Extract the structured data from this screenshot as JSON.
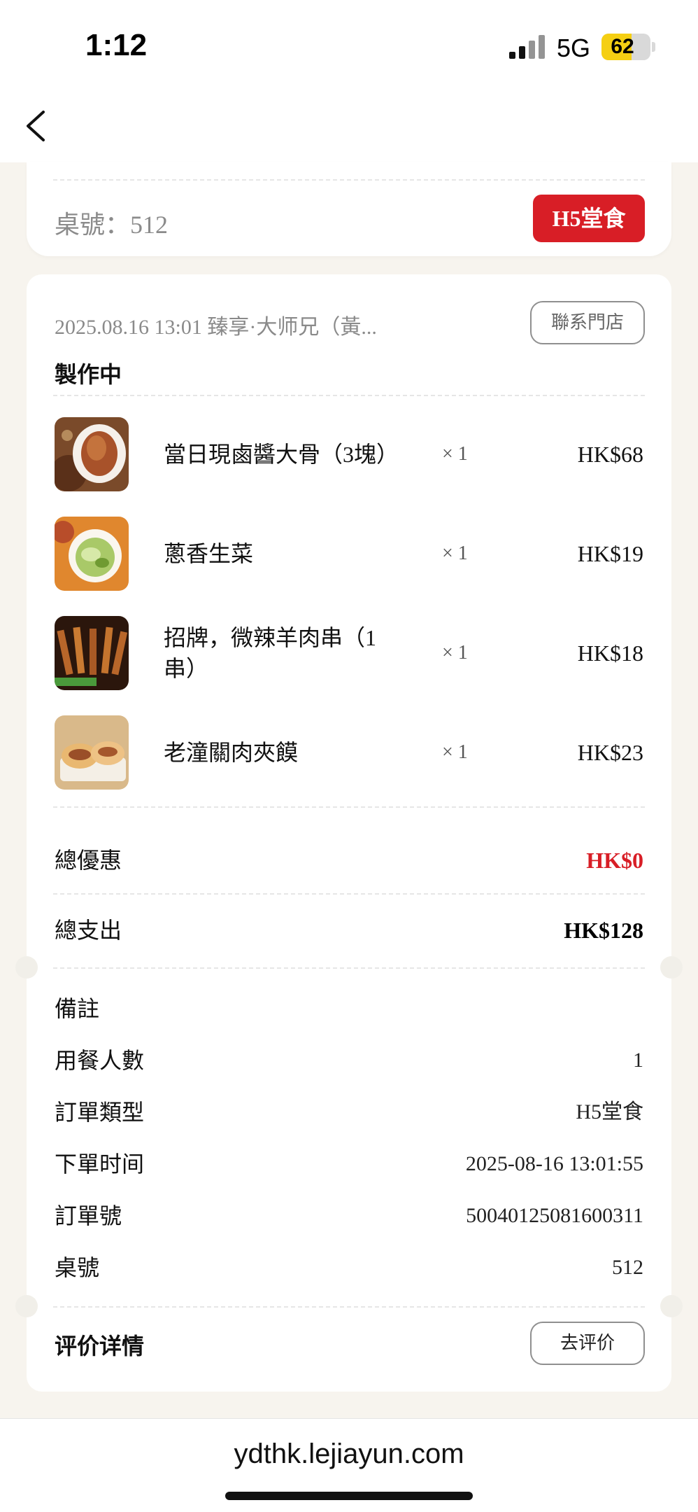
{
  "status_bar": {
    "time": "1:12",
    "network": "5G",
    "battery": "62",
    "battery_level": 0.62
  },
  "icons": {
    "back": "chevron-left-icon",
    "signal": "signal-bars-icon",
    "battery": "battery-icon"
  },
  "colors": {
    "accent": "#d81e26",
    "battery": "#f5cf13",
    "background": "#f7f4ee"
  },
  "table_card": {
    "table_label": "桌號：512",
    "mode_badge": "H5堂食"
  },
  "order": {
    "meta": "2025.08.16 13:01  臻享·大师兄（黃...",
    "contact_button": "聯系門店",
    "status": "製作中",
    "items": [
      {
        "name": "當日現鹵醬大骨（3塊）",
        "qty": "× 1",
        "price": "HK$68",
        "thumb": "braised-bone-dish"
      },
      {
        "name": "蔥香生菜",
        "qty": "× 1",
        "price": "HK$19",
        "thumb": "lettuce-dish"
      },
      {
        "name": "招牌，微辣羊肉串（1串）",
        "qty": "× 1",
        "price": "HK$18",
        "thumb": "lamb-skewer-dish"
      },
      {
        "name": "老潼關肉夾饃",
        "qty": "× 1",
        "price": "HK$23",
        "thumb": "roujiamo-dish"
      }
    ],
    "discount_label": "總優惠",
    "discount_value": "HK$0",
    "total_label": "總支出",
    "total_value": "HK$128"
  },
  "details": {
    "remarks_label": "備註",
    "rows": [
      {
        "label": "用餐人數",
        "value": "1"
      },
      {
        "label": "訂單類型",
        "value": "H5堂食"
      },
      {
        "label": "下單时间",
        "value": "2025-08-16 13:01:55"
      },
      {
        "label": "訂單號",
        "value": "50040125081600311"
      },
      {
        "label": "桌號",
        "value": "512"
      }
    ]
  },
  "review": {
    "title": "评价详情",
    "button": "去评价"
  },
  "browser": {
    "url": "ydthk.lejiayun.com"
  }
}
